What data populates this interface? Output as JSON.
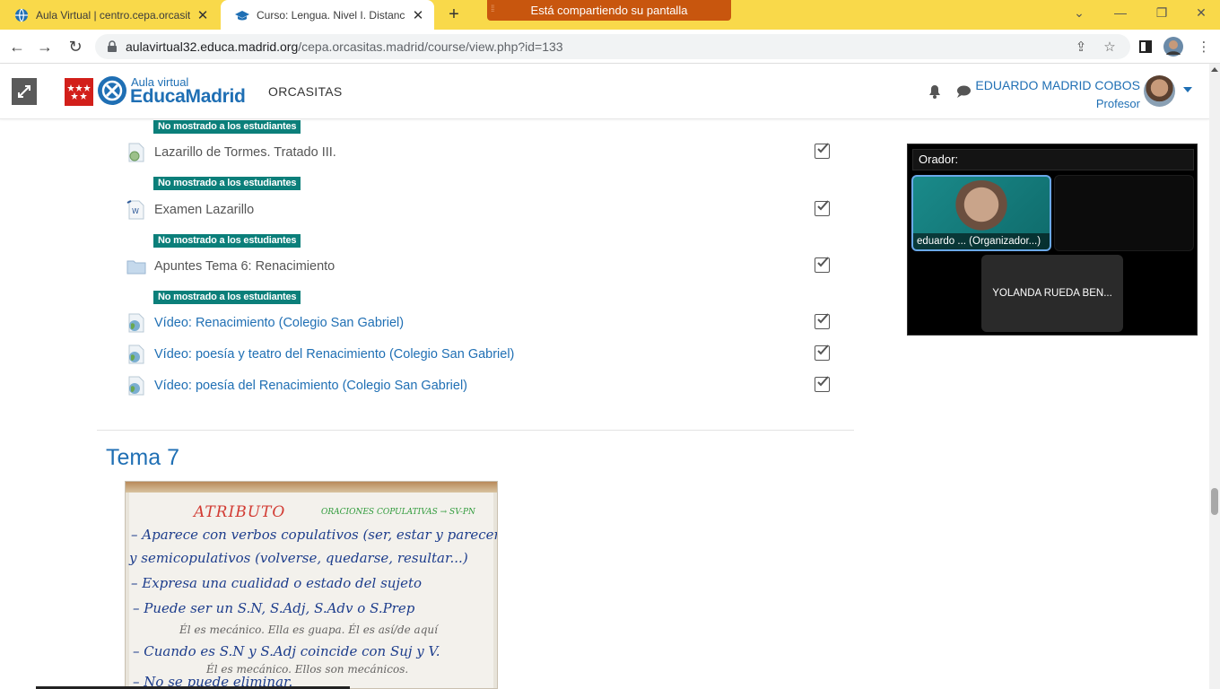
{
  "browser": {
    "tabs": [
      {
        "title": "Aula Virtual | centro.cepa.orcasitas",
        "active": false,
        "icon": "globe-icon"
      },
      {
        "title": "Curso: Lengua. Nivel I. Distancia",
        "active": true,
        "icon": "graduation-cap-icon"
      }
    ],
    "sharing_banner": "Está compartiendo su pantalla",
    "url_host": "aulavirtual32.educa.madrid.org",
    "url_path": "/cepa.orcasitas.madrid/course/view.php?id=133",
    "tab_strip_color": "#f9d94a",
    "sharing_color": "#c8560e"
  },
  "header": {
    "logo_top": "Aula virtual",
    "logo_main": "EducaMadrid",
    "site_name": "ORCASITAS",
    "user_name": "EDUARDO MADRID COBOS",
    "user_role": "Profesor",
    "accent": "#1f6fb4"
  },
  "course": {
    "hidden_badge": "No mostrado a los estudiantes",
    "activities": [
      {
        "name": "Lazarillo de Tormes. Tratado III.",
        "type": "url",
        "is_link": false,
        "completed": true
      },
      {
        "name": "Examen Lazarillo",
        "type": "file",
        "is_link": false,
        "completed": true
      },
      {
        "name": "Apuntes Tema 6: Renacimiento",
        "type": "folder",
        "is_link": false,
        "completed": true
      },
      {
        "name": "Vídeo: Renacimiento (Colegio San Gabriel)",
        "type": "url",
        "is_link": true,
        "completed": true
      },
      {
        "name": "Vídeo: poesía y teatro del Renacimiento (Colegio San Gabriel)",
        "type": "url",
        "is_link": true,
        "completed": true
      },
      {
        "name": "Vídeo: poesía del Renacimiento (Colegio San Gabriel)",
        "type": "url",
        "is_link": true,
        "completed": true
      }
    ],
    "next_section_title": "Tema 7",
    "whiteboard": {
      "title": "ATRIBUTO",
      "subtitle": "ORACIONES COPULATIVAS → SV-PN",
      "lines": [
        "– Aparece con verbos copulativos (ser, estar y parecer)",
        "y semicopulativos (volverse, quedarse, resultar...)",
        "– Expresa una cualidad o estado del sujeto",
        "– Puede ser un S.N, S.Adj, S.Adv o S.Prep",
        "– Cuando es S.N y S.Adj coincide con Suj y V.",
        "– No se puede eliminar."
      ],
      "examples": [
        "Él es mecánico. Ella es guapa. Él es así/de aquí",
        "Él es mecánico. Ellos son mecánicos."
      ]
    }
  },
  "meeting": {
    "speaker_label": "Orador:",
    "organizer_name": "eduardo ... (Organizador...)",
    "participant_name": "YOLANDA RUEDA BEN..."
  }
}
